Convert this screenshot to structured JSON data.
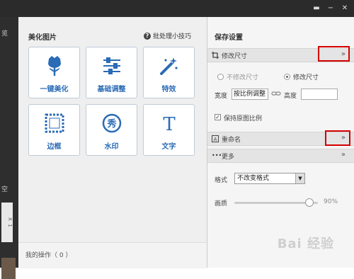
{
  "window": {
    "btn_menu": "▬",
    "btn_min": "−",
    "btn_close": "✕"
  },
  "left_strip": {
    "label_top": "览",
    "label_mid": "空",
    "chip_text": "X  1"
  },
  "beautify": {
    "title": "美化图片",
    "tip": "批处理小技巧",
    "tiles": [
      {
        "label": "一键美化",
        "icon": "tulip-icon"
      },
      {
        "label": "基础调整",
        "icon": "sliders-icon"
      },
      {
        "label": "特效",
        "icon": "magic-wand-icon"
      },
      {
        "label": "边框",
        "icon": "frame-icon"
      },
      {
        "label": "水印",
        "icon": "watermark-seal-icon"
      },
      {
        "label": "文字",
        "icon": "text-t-icon"
      }
    ],
    "my_ops": "我的操作（ 0 ）"
  },
  "save_settings": {
    "title": "保存设置",
    "resize": {
      "label": "修改尺寸",
      "opt_keep": "不修改尺寸",
      "opt_change": "修改尺寸",
      "width_label": "宽度",
      "width_value": "按比例调整",
      "height_label": "高度",
      "height_value": "",
      "keep_ratio": "保持原图比例"
    },
    "rename": {
      "label": "重命名"
    },
    "more": {
      "label": "更多",
      "format_label": "格式",
      "format_value": "不改变格式",
      "quality_label": "画质",
      "quality_text": "90%",
      "quality_value": 0.9
    }
  },
  "watermark_text": "Bai 经验",
  "colors": {
    "accent": "#2a6bb5",
    "highlight": "#d40000"
  }
}
